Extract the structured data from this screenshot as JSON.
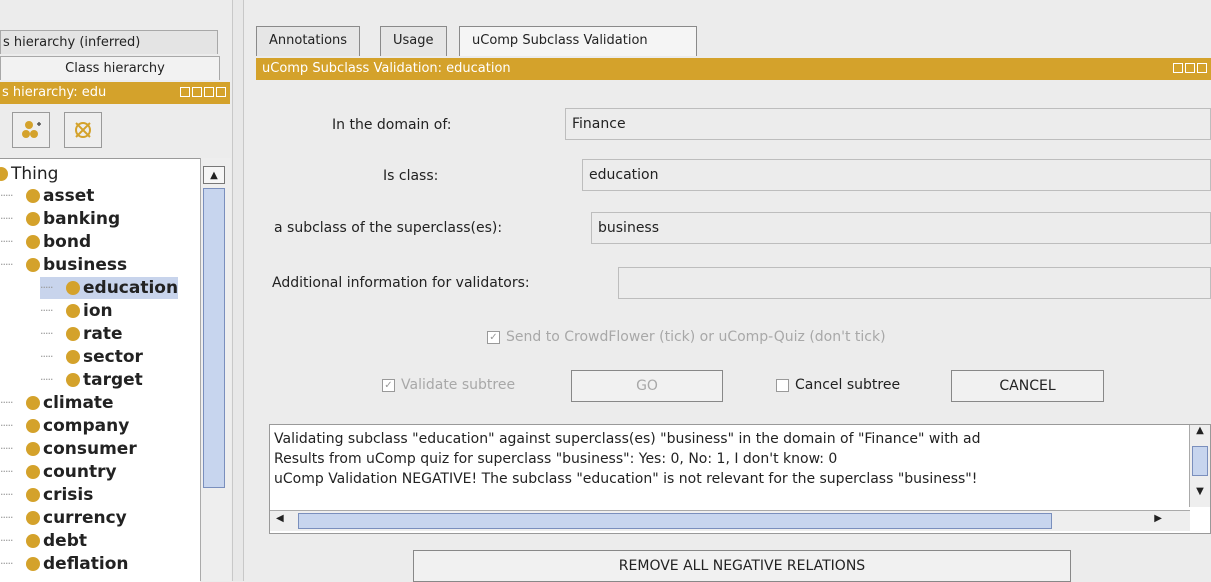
{
  "left": {
    "tab_inferred": "s hierarchy (inferred)",
    "tab_class": "Class hierarchy",
    "panel_title": "s hierarchy: edu",
    "toolbar": {
      "add_sub_icon": "add-subclass-icon",
      "delete_icon": "delete-class-icon"
    },
    "tree": {
      "root": "Thing",
      "items": [
        {
          "label": "asset",
          "level": 1
        },
        {
          "label": "banking",
          "level": 1
        },
        {
          "label": "bond",
          "level": 1
        },
        {
          "label": "business",
          "level": 1
        },
        {
          "label": "education",
          "level": 2,
          "selected": true
        },
        {
          "label": "ion",
          "level": 2
        },
        {
          "label": "rate",
          "level": 2
        },
        {
          "label": "sector",
          "level": 2
        },
        {
          "label": "target",
          "level": 2
        },
        {
          "label": "climate",
          "level": 1
        },
        {
          "label": "company",
          "level": 1
        },
        {
          "label": "consumer",
          "level": 1
        },
        {
          "label": "country",
          "level": 1
        },
        {
          "label": "crisis",
          "level": 1
        },
        {
          "label": "currency",
          "level": 1
        },
        {
          "label": "debt",
          "level": 1
        },
        {
          "label": "deflation",
          "level": 1
        }
      ]
    }
  },
  "right": {
    "tabs": [
      "Annotations",
      "Usage",
      "uComp Subclass Validation"
    ],
    "panel_title": "uComp Subclass Validation: education",
    "domain_label": "In the domain of:",
    "domain_value": "Finance",
    "class_label": "Is class:",
    "class_value": "education",
    "superclass_label": "a subclass of the superclass(es):",
    "superclass_value": "business",
    "additional_label": "Additional information for validators:",
    "additional_value": "",
    "send_checkbox_label": "Send to CrowdFlower (tick) or uComp-Quiz (don't tick)",
    "validate_checkbox_label": "Validate subtree",
    "go_button": "GO",
    "cancel_checkbox_label": "Cancel subtree",
    "cancel_button": "CANCEL",
    "log_lines": [
      "Validating subclass \"education\" against superclass(es) \"business\" in the domain of \"Finance\" with ad",
      "Results from uComp quiz for superclass \"business\": Yes: 0, No: 1, I don't know: 0",
      "uComp Validation NEGATIVE! The subclass \"education\" is not relevant for the superclass \"business\"!"
    ],
    "remove_button": "REMOVE ALL NEGATIVE RELATIONS"
  },
  "colors": {
    "accent": "#d4a22b",
    "selection": "#c8d4ec",
    "scroll_thumb": "#c7d5ee"
  }
}
